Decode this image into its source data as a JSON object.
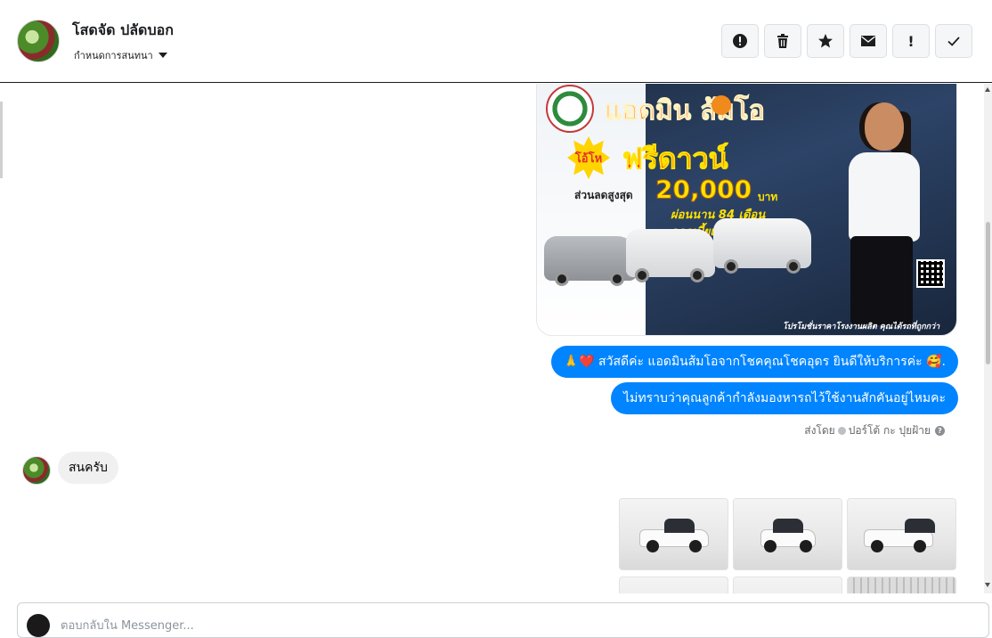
{
  "header": {
    "contact_name": "โสดจัด ปลัดบอก",
    "subtitle": "กำหนดการสนทนา",
    "toolbar": [
      {
        "name": "report-icon"
      },
      {
        "name": "trash-icon"
      },
      {
        "name": "star-icon"
      },
      {
        "name": "mail-icon"
      },
      {
        "name": "important-icon",
        "glyph": "!"
      },
      {
        "name": "check-icon"
      }
    ]
  },
  "promo_image": {
    "title": "แอดมิน ส้มโอ",
    "badge": "โอ้โห",
    "headline": "ฟรีดาวน์",
    "discount_label": "ส่วนลดสูงสุด",
    "discount_amount": "20,000",
    "discount_unit": "บาท",
    "installment": "ผ่อนนาน 84 เดือน",
    "rate": "ดอกเบี้ยเริ่ม 2.49%",
    "footer": "โปรโมชั่นราคาโรงงานผลิต คุณได้รถที่ถูกกว่า"
  },
  "messages": {
    "outgoing_1": "🙏❤️ สวัสดีค่ะ แอดมินส้มโอจากโชคคุณโชคอุดร ยินดีให้บริการค่ะ 🥰.",
    "outgoing_2": "ไม่ทราบว่าคุณลูกค้ากำลังมองหารถไว้ใช้งานสักคันอยู่ไหมคะ",
    "sent_by_label": "ส่งโดย",
    "sent_by_name": "ปอร์โต้ กะ ปุยฝ้าย",
    "sent_by_help": "?",
    "incoming_1": "สนครับ"
  },
  "compose": {
    "placeholder": "ตอบกลับใน Messenger..."
  }
}
